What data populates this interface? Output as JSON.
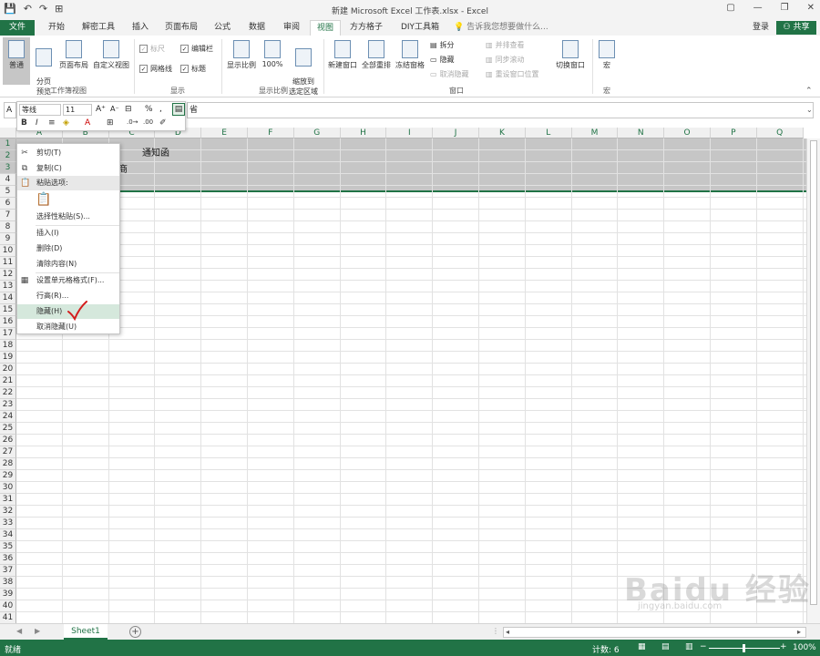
{
  "title_bar": {
    "title": "新建 Microsoft Excel 工作表.xlsx - Excel",
    "qat": [
      "💾",
      "↶",
      "↷",
      "⊞"
    ],
    "window_controls": [
      "▢",
      "—",
      "❐",
      "✕"
    ]
  },
  "tabs": [
    {
      "label": "文件",
      "kind": "file"
    },
    {
      "label": "开始"
    },
    {
      "label": "解密工具"
    },
    {
      "label": "插入"
    },
    {
      "label": "页面布局"
    },
    {
      "label": "公式"
    },
    {
      "label": "数据"
    },
    {
      "label": "审阅"
    },
    {
      "label": "视图",
      "kind": "active"
    },
    {
      "label": "方方格子"
    },
    {
      "label": "DIY工具箱"
    }
  ],
  "tell_me": "告诉我您想要做什么...",
  "login": "登录",
  "share": "共享",
  "ribbon": {
    "views": {
      "normal": "普通",
      "page_break": "分页\n预览",
      "page_layout": "页面布局",
      "custom": "自定义视图",
      "group": "工作簿视图"
    },
    "show": {
      "ruler": "标尺",
      "formula_bar": "编辑栏",
      "gridlines": "网格线",
      "headings": "标题",
      "group": "显示"
    },
    "zoom": {
      "zoom": "显示比例",
      "hundred": "100%",
      "to_selection": "缩放到\n选定区域",
      "group": "显示比例"
    },
    "window": {
      "new_window": "新建窗口",
      "arrange_all": "全部重排",
      "freeze": "冻结窗格",
      "split": "拆分",
      "hide": "隐藏",
      "unhide": "取消隐藏",
      "side_by_side": "并排查看",
      "sync_scroll": "同步滚动",
      "reset_pos": "重设窗口位置",
      "switch": "切换窗口",
      "group": "窗口"
    },
    "macros": {
      "macros": "宏",
      "group": "宏"
    }
  },
  "formula_bar": {
    "name_box": "A",
    "content": "省"
  },
  "mini_toolbar": {
    "font": "等线",
    "size": "11"
  },
  "grid": {
    "columns": [
      "A",
      "B",
      "C",
      "D",
      "E",
      "F",
      "G",
      "H",
      "I",
      "J",
      "K",
      "L",
      "M",
      "N",
      "O",
      "P",
      "Q"
    ],
    "rows": [
      "1",
      "2",
      "3",
      "4",
      "5",
      "6",
      "7",
      "8",
      "9",
      "10",
      "11",
      "12",
      "13",
      "14",
      "15",
      "16",
      "17",
      "18",
      "19",
      "20",
      "21",
      "22",
      "23",
      "24",
      "25",
      "26",
      "27",
      "28",
      "29",
      "30",
      "31",
      "32",
      "33",
      "34",
      "35",
      "36",
      "37",
      "38",
      "39",
      "40",
      "41"
    ],
    "cell_C1": "通知函",
    "cell_C2": "销售商"
  },
  "context_menu": [
    {
      "label": "剪切(T)",
      "icon": "✂"
    },
    {
      "label": "复制(C)",
      "icon": "⧉"
    },
    {
      "label": "粘贴选项:",
      "icon": "📋",
      "kind": "header"
    },
    {
      "label": "",
      "icon": "📋",
      "kind": "paste-icon"
    },
    {
      "label": "选择性粘贴(S)...",
      "icon": ""
    },
    {
      "label": "插入(I)",
      "icon": ""
    },
    {
      "label": "删除(D)",
      "icon": ""
    },
    {
      "label": "清除内容(N)",
      "icon": ""
    },
    {
      "label": "设置单元格格式(F)...",
      "icon": "▦"
    },
    {
      "label": "行高(R)...",
      "icon": ""
    },
    {
      "label": "隐藏(H)",
      "icon": "",
      "kind": "highlight"
    },
    {
      "label": "取消隐藏(U)",
      "icon": ""
    }
  ],
  "sheet_tabs": [
    "Sheet1"
  ],
  "status_bar": {
    "ready": "就绪",
    "count": "计数: 6",
    "zoom": "100%"
  },
  "watermark": {
    "main": "Baidu 经验",
    "sub": "jingyan.baidu.com"
  }
}
